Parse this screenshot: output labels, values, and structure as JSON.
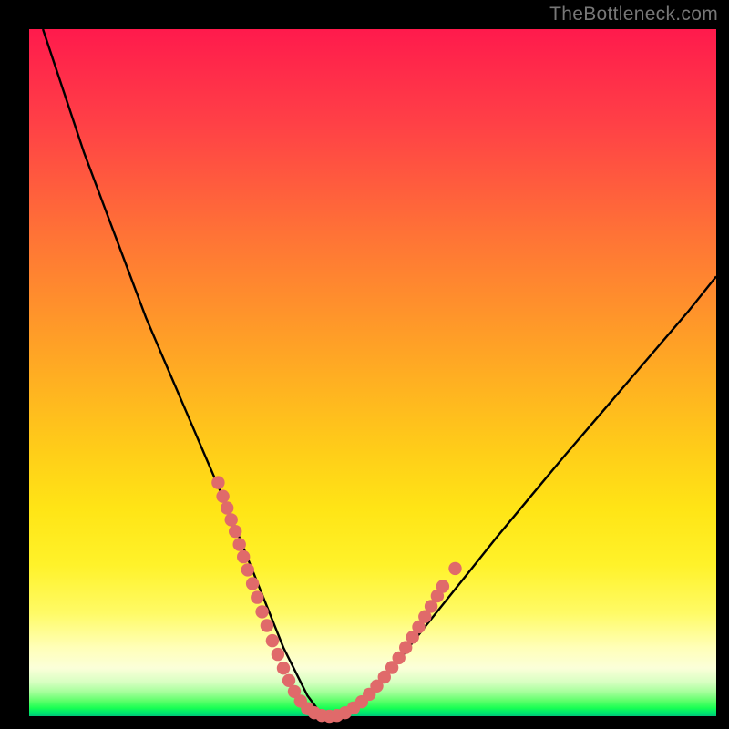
{
  "watermark": "TheBottleneck.com",
  "colors": {
    "curve": "#000000",
    "markers": "#e06a6a",
    "background_black": "#000000"
  },
  "chart_data": {
    "type": "line",
    "title": "",
    "xlabel": "",
    "ylabel": "",
    "xlim": [
      0,
      100
    ],
    "ylim": [
      0,
      100
    ],
    "series": [
      {
        "name": "bottleneck-curve",
        "x": [
          2,
          5,
          8,
          11,
          14,
          17,
          20,
          23,
          26,
          29,
          31,
          33,
          35,
          37,
          39,
          40.5,
          42,
          44,
          46,
          48,
          50,
          53,
          56,
          60,
          64,
          68,
          73,
          78,
          84,
          90,
          96,
          100
        ],
        "y": [
          100,
          91,
          82,
          74,
          66,
          58,
          51,
          44,
          37,
          30,
          25,
          20,
          15,
          10,
          6,
          3,
          1,
          0,
          0.5,
          2,
          4,
          7,
          11,
          16,
          21,
          26,
          32,
          38,
          45,
          52,
          59,
          64
        ]
      }
    ],
    "markers": {
      "name": "highlighted-points",
      "note": "pink dot clusters along both flanks near the valley",
      "points": [
        {
          "x": 27.5,
          "y": 34
        },
        {
          "x": 28.2,
          "y": 32
        },
        {
          "x": 28.8,
          "y": 30.3
        },
        {
          "x": 29.4,
          "y": 28.6
        },
        {
          "x": 30.0,
          "y": 26.9
        },
        {
          "x": 30.6,
          "y": 25.0
        },
        {
          "x": 31.2,
          "y": 23.2
        },
        {
          "x": 31.8,
          "y": 21.3
        },
        {
          "x": 32.5,
          "y": 19.3
        },
        {
          "x": 33.2,
          "y": 17.3
        },
        {
          "x": 33.9,
          "y": 15.2
        },
        {
          "x": 34.6,
          "y": 13.2
        },
        {
          "x": 35.4,
          "y": 11.0
        },
        {
          "x": 36.2,
          "y": 9.0
        },
        {
          "x": 37.0,
          "y": 7.0
        },
        {
          "x": 37.8,
          "y": 5.2
        },
        {
          "x": 38.6,
          "y": 3.6
        },
        {
          "x": 39.5,
          "y": 2.2
        },
        {
          "x": 40.5,
          "y": 1.1
        },
        {
          "x": 41.5,
          "y": 0.5
        },
        {
          "x": 42.6,
          "y": 0.1
        },
        {
          "x": 43.7,
          "y": 0.0
        },
        {
          "x": 44.8,
          "y": 0.1
        },
        {
          "x": 46.0,
          "y": 0.5
        },
        {
          "x": 47.2,
          "y": 1.2
        },
        {
          "x": 48.4,
          "y": 2.1
        },
        {
          "x": 49.5,
          "y": 3.2
        },
        {
          "x": 50.6,
          "y": 4.4
        },
        {
          "x": 51.7,
          "y": 5.7
        },
        {
          "x": 52.8,
          "y": 7.1
        },
        {
          "x": 53.8,
          "y": 8.5
        },
        {
          "x": 54.8,
          "y": 10.0
        },
        {
          "x": 55.8,
          "y": 11.5
        },
        {
          "x": 56.7,
          "y": 13.0
        },
        {
          "x": 57.6,
          "y": 14.5
        },
        {
          "x": 58.5,
          "y": 16.0
        },
        {
          "x": 59.4,
          "y": 17.5
        },
        {
          "x": 60.2,
          "y": 18.9
        },
        {
          "x": 62.0,
          "y": 21.5
        }
      ]
    }
  }
}
